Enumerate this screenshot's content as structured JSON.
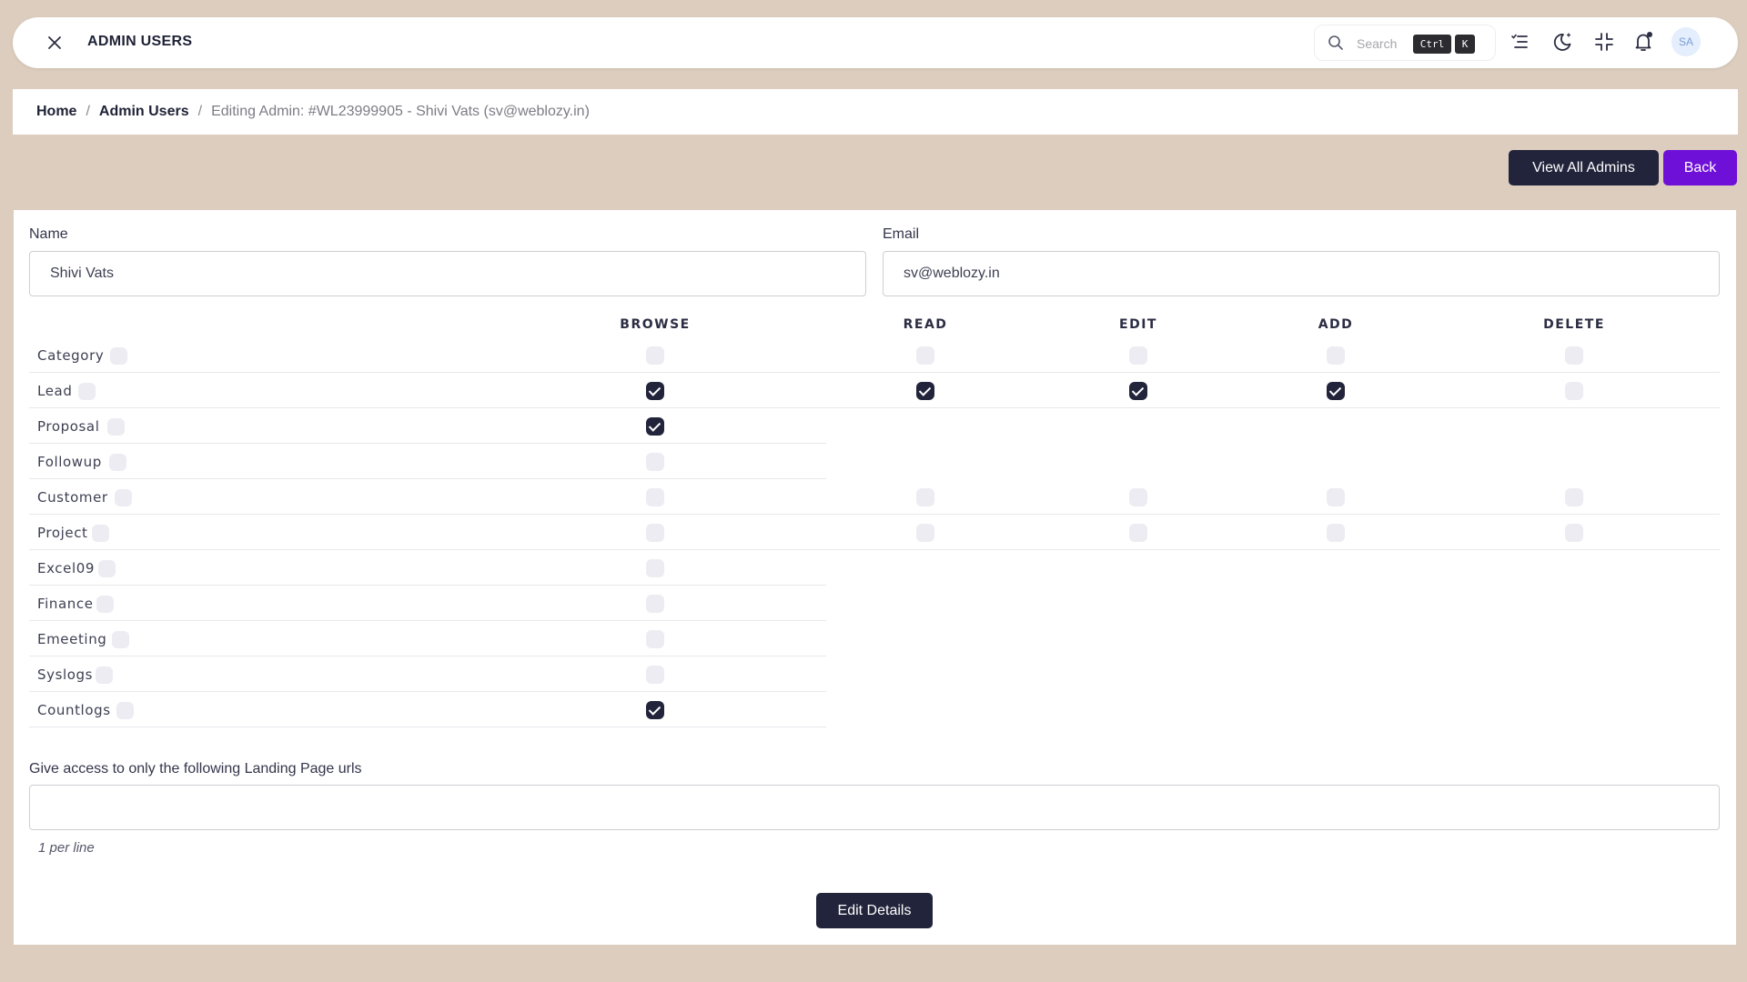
{
  "header": {
    "title": "ADMIN USERS",
    "search_placeholder": "Search",
    "shortcut_ctrl": "Ctrl",
    "shortcut_key": "K",
    "avatar_initials": "SA",
    "icons": [
      "close-icon",
      "search-icon",
      "menu-lines-icon",
      "moon-icon",
      "collapse-icon",
      "bell-icon"
    ]
  },
  "breadcrumb": {
    "home": "Home",
    "section": "Admin Users",
    "current": "Editing Admin: #WL23999905 - Shivi Vats (sv@weblozy.in)"
  },
  "actions": {
    "view_all": "View All Admins",
    "back": "Back"
  },
  "form": {
    "name_label": "Name",
    "name_value": "Shivi Vats",
    "email_label": "Email",
    "email_value": "sv@weblozy.in"
  },
  "permissions": {
    "columns": [
      "BROWSE",
      "READ",
      "EDIT",
      "ADD",
      "DELETE"
    ],
    "rows": [
      {
        "label": "Category",
        "browse": false,
        "read": false,
        "edit": false,
        "add": false,
        "delete": false
      },
      {
        "label": "Lead",
        "browse": true,
        "read": true,
        "edit": true,
        "add": true,
        "delete": false
      },
      {
        "label": "Proposal",
        "browse": true
      },
      {
        "label": "Followup",
        "browse": false
      },
      {
        "label": "Customer",
        "browse": false,
        "read": false,
        "edit": false,
        "add": false,
        "delete": false
      },
      {
        "label": "Project",
        "browse": false,
        "read": false,
        "edit": false,
        "add": false,
        "delete": false
      },
      {
        "label": "Excel09",
        "browse": false
      },
      {
        "label": "Finance",
        "browse": false
      },
      {
        "label": "Emeeting",
        "browse": false
      },
      {
        "label": "Syslogs",
        "browse": false
      },
      {
        "label": "Countlogs",
        "browse": true
      }
    ]
  },
  "landing": {
    "label": "Give access to only the following Landing Page urls",
    "value": "",
    "hint": "1 per line"
  },
  "submit_label": "Edit Details",
  "colors": {
    "background": "#dccdbe",
    "dark": "#22243b",
    "accent": "#6f10d8"
  }
}
